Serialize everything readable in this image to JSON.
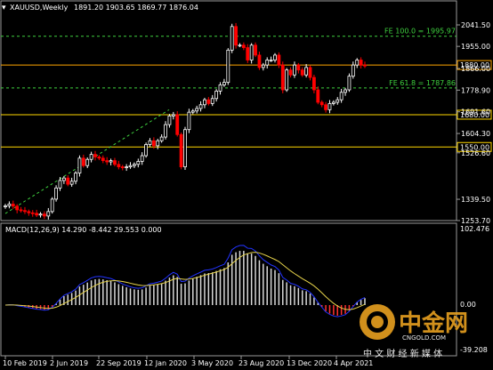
{
  "header": {
    "symbol": "XAUUSD,Weekly",
    "ohlc": "1891.20 1903.65 1869.77 1876.04"
  },
  "macd": {
    "label": "MACD(12,26,9) 14.290 -8.442 29.553 0.000",
    "axis": {
      "top": "102.476",
      "zero": "0.00",
      "bottom": "-39.208"
    }
  },
  "price_axis": [
    {
      "label": "2041.50",
      "value": 2041.5
    },
    {
      "label": "1955.00",
      "value": 1955.0
    },
    {
      "label": "1866.00",
      "value": 1866.0
    },
    {
      "label": "1778.90",
      "value": 1778.9
    },
    {
      "label": "1691.60",
      "value": 1691.6
    },
    {
      "label": "1604.30",
      "value": 1604.3
    },
    {
      "label": "1526.60",
      "value": 1526.6
    },
    {
      "label": "1339.50",
      "value": 1339.5
    },
    {
      "label": "1253.70",
      "value": 1253.7
    }
  ],
  "levels": [
    {
      "label": "1880.00",
      "value": 1880.0,
      "color": "#ffa500"
    },
    {
      "label": "1680.00",
      "value": 1680.0,
      "color": "#ffd700"
    },
    {
      "label": "1550.00",
      "value": 1550.0,
      "color": "#ffd700"
    }
  ],
  "fib": [
    {
      "label": "FE 100.0 = 1995.97",
      "value": 1995.97
    },
    {
      "label": "FE 61.8 = 1787.86",
      "value": 1787.86
    }
  ],
  "time_axis": [
    "10 Feb 2019",
    "2 Jun 2019",
    "22 Sep 2019",
    "12 Jan 2020",
    "3 May 2020",
    "23 Aug 2020",
    "13 Dec 2020",
    "4 Apr 2021"
  ],
  "watermark": {
    "brand": "中金网",
    "sub": "CNGOLD.COM",
    "tagline": "中 文 财 经 新 媒 体"
  },
  "chart_data": {
    "type": "candlestick",
    "series": [
      {
        "name": "XAUUSD",
        "values": [
          1313,
          1320,
          1312,
          1297,
          1294,
          1290,
          1285,
          1283,
          1276,
          1280,
          1272,
          1290,
          1340,
          1385,
          1415,
          1425,
          1400,
          1412,
          1445,
          1505,
          1475,
          1500,
          1520,
          1510,
          1505,
          1495,
          1490,
          1495,
          1480,
          1470,
          1468,
          1470,
          1475,
          1480,
          1492,
          1515,
          1560,
          1575,
          1555,
          1575,
          1590,
          1640,
          1675,
          1680,
          1600,
          1470,
          1620,
          1690,
          1695,
          1705,
          1720,
          1740,
          1725,
          1745,
          1775,
          1800,
          1810,
          1940,
          2035,
          1960,
          1960,
          1950,
          1900,
          1960,
          1920,
          1870,
          1880,
          1900,
          1900,
          1920,
          1880,
          1780,
          1860,
          1840,
          1880,
          1860,
          1840,
          1870,
          1830,
          1780,
          1730,
          1720,
          1700,
          1725,
          1730,
          1740,
          1770,
          1780,
          1835,
          1880,
          1900,
          1880,
          1876
        ]
      }
    ]
  },
  "colors": {
    "up": "#ffffff",
    "down": "#ff0000",
    "grid": "#ffffff",
    "signal": "#e6d34b",
    "macd_line": "#2233ff"
  }
}
